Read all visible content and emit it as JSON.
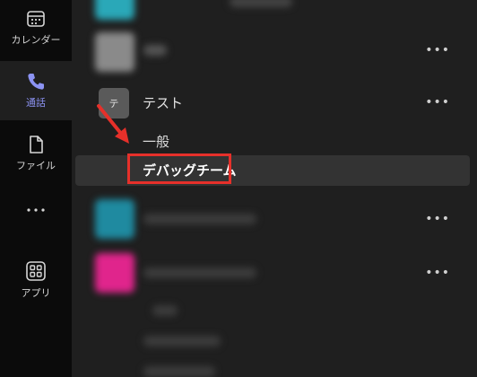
{
  "rail": {
    "items": [
      {
        "label": "カレンダー",
        "icon": "calendar-icon"
      },
      {
        "label": "通話",
        "icon": "phone-icon",
        "active": true
      },
      {
        "label": "ファイル",
        "icon": "file-icon"
      },
      {
        "label": "",
        "icon": "more-apps-icon"
      },
      {
        "label": "アプリ",
        "icon": "apps-icon"
      }
    ],
    "active_color": "#8c93f3"
  },
  "teams": {
    "more_label": "•••",
    "selected_team": {
      "avatar_text": "テ",
      "name": "テスト",
      "channels": [
        "一般",
        "デバッグチーム"
      ]
    }
  },
  "annotation": {
    "box_color": "#e6302a"
  }
}
